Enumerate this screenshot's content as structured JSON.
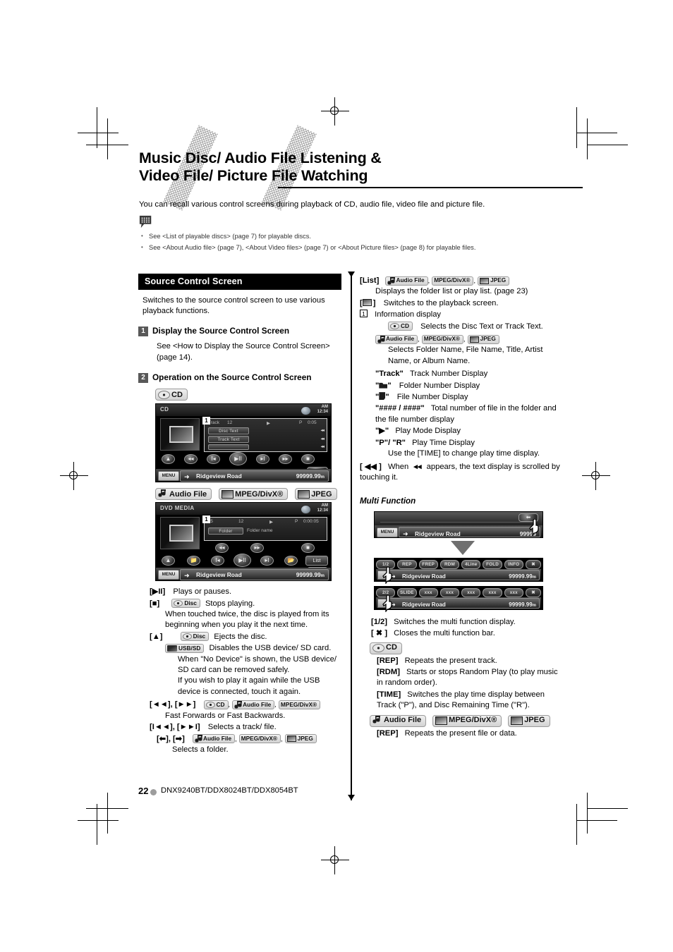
{
  "page": {
    "title_line1": "Music Disc/ Audio File Listening &",
    "title_line2": "Video File/ Picture File Watching",
    "intro": "You can recall various control screens during playback of CD, audio file, video file and picture file.",
    "bullets": [
      "See <List of playable discs> (page 7) for playable discs.",
      "See <About Audio file> (page 7), <About Video files> (page 7) or <About Picture files> (page 8) for playable files."
    ],
    "page_number": "22",
    "model_line": "DNX9240BT/DDX8024BT/DDX8054BT"
  },
  "badges": {
    "cd": "CD",
    "disc": "Disc",
    "usb_sd": "USB/SD",
    "audio_file": "Audio File",
    "mpeg_divx": "MPEG/DivX®",
    "jpeg": "JPEG"
  },
  "left": {
    "section_title": "Source Control Screen",
    "lead": "Switches to the source control screen to use various playback functions.",
    "step1": {
      "num": "1",
      "title": "Display the Source Control Screen",
      "body": "See <How to Display the Source Control Screen> (page 14)."
    },
    "step2": {
      "num": "2",
      "title": "Operation on the Source Control Screen"
    },
    "cd_screen": {
      "source": "CD",
      "clock_am": "AM",
      "clock_time": "12:34",
      "callout": "1",
      "track_label": "Track",
      "track_num": "12",
      "play_glyph": "▶",
      "time_mode": "P",
      "time": "0:05",
      "row1": "Disc Text",
      "row2": "Track Text",
      "menu": "MENU",
      "now_playing": "Ridgeview Road",
      "distance": "99999.99",
      "distance_unit": "m"
    },
    "media_screen": {
      "source": "DVD MEDIA",
      "clock_am": "AM",
      "clock_time": "12:34",
      "callout": "1",
      "folder_num": "♪5",
      "file_num": "12",
      "play_glyph": "▶",
      "time_mode": "P",
      "time": "0:00:05",
      "row1": "Folder",
      "row2": "Folder name",
      "list_btn": "List",
      "menu": "MENU",
      "now_playing": "Ridgeview Road",
      "distance": "99999.99",
      "distance_unit": "m"
    },
    "keys": [
      {
        "key": "[▶II]",
        "badges": [],
        "text": "Plays or pauses."
      },
      {
        "key": "[■]",
        "badges": [
          "disc"
        ],
        "text": "Stops playing."
      },
      {
        "key": "",
        "badges": [],
        "text": "When touched twice, the disc is played from its beginning when you play it the next time."
      },
      {
        "key": "[▲]",
        "badges": [
          "disc"
        ],
        "text": "Ejects the disc."
      },
      {
        "key": "",
        "badges": [
          "usb_sd"
        ],
        "text": "Disables the USB device/ SD card."
      },
      {
        "key": "",
        "badges": [],
        "text": "When \"No Device\" is shown, the USB device/ SD card can be removed safely."
      },
      {
        "key": "",
        "badges": [],
        "text": "If you wish to play it again while the USB device is connected, touch it again."
      },
      {
        "key": "[◄◄], [►►]",
        "badges": [
          "cd",
          "audio_file",
          "mpeg_divx"
        ],
        "text": "Fast Forwards or Fast Backwards."
      },
      {
        "key": "[I◄◄], [►►I]",
        "badges": [],
        "text": "Selects a track/ file."
      },
      {
        "key": "[⬅], [➡]",
        "badges": [
          "audio_file",
          "mpeg_divx",
          "jpeg"
        ],
        "text": "Selects a folder."
      }
    ]
  },
  "right": {
    "list_key": "[List]",
    "list_badges": [
      "audio_file",
      "mpeg_divx",
      "jpeg"
    ],
    "list_text": "Displays the folder list or play list. (page 23)",
    "playback_key": "[⬜]",
    "playback_text": "Switches to the playback screen.",
    "info_num": "1",
    "info_title": "Information display",
    "cd_info_text": "Selects the Disc Text or Track Text.",
    "media_info_text": "Selects Folder Name, File Name, Title, Artist Name, or Album Name.",
    "items": [
      {
        "key": "\"Track\"",
        "text": "Track Number Display"
      },
      {
        "key": "\"▬\"",
        "text": "Folder Number Display"
      },
      {
        "key": "\"☷\"",
        "text": "File Number Display"
      },
      {
        "key": "\"#### / ####\"",
        "text": "Total number of file in the folder and the file number display"
      },
      {
        "key": "\"▶\"",
        "text": "Play Mode Display"
      },
      {
        "key": "\"P\"/ \"R\"",
        "text": "Play Time Display"
      }
    ],
    "time_note": "Use the [TIME] to change play time display.",
    "scroll_key": "[ ◀◀ ]",
    "scroll_text_a": "When",
    "scroll_text_b": "appears, the text display is scrolled by touching it.",
    "multi_function_heading": "Multi Function",
    "mf_screen_top": {
      "menu": "MENU",
      "now_playing": "Ridgeview Road",
      "distance": "99999"
    },
    "mf_screen_1": {
      "buttons": [
        "1/2",
        "REP",
        "FREP",
        "RDM",
        "4Line",
        "FOLD",
        "INFO",
        "✖"
      ],
      "now_playing": "Ridgeview Road",
      "distance": "99999.99",
      "distance_unit": "m"
    },
    "mf_screen_2": {
      "buttons": [
        "2/2",
        "SLIDE",
        "xxx",
        "xxx",
        "xxx",
        "xxx",
        "xxx",
        "✖"
      ],
      "now_playing": "Ridgeview Road",
      "distance": "99999.99",
      "distance_unit": "m"
    },
    "mf_keys": [
      {
        "key": "[1/2]",
        "text": "Switches the multi function display."
      },
      {
        "key": "[ ✖ ]",
        "text": "Closes the multi function bar."
      }
    ],
    "cd_group_keys": [
      {
        "key": "[REP]",
        "text": "Repeats the present track."
      },
      {
        "key": "[RDM]",
        "text": "Starts or stops Random Play (to play music in random order)."
      },
      {
        "key": "[TIME]",
        "text": "Switches the play time display between Track (\"P\"), and Disc Remaining Time (\"R\")."
      }
    ],
    "media_group_keys": [
      {
        "key": "[REP]",
        "text": "Repeats the present file or data."
      }
    ]
  }
}
